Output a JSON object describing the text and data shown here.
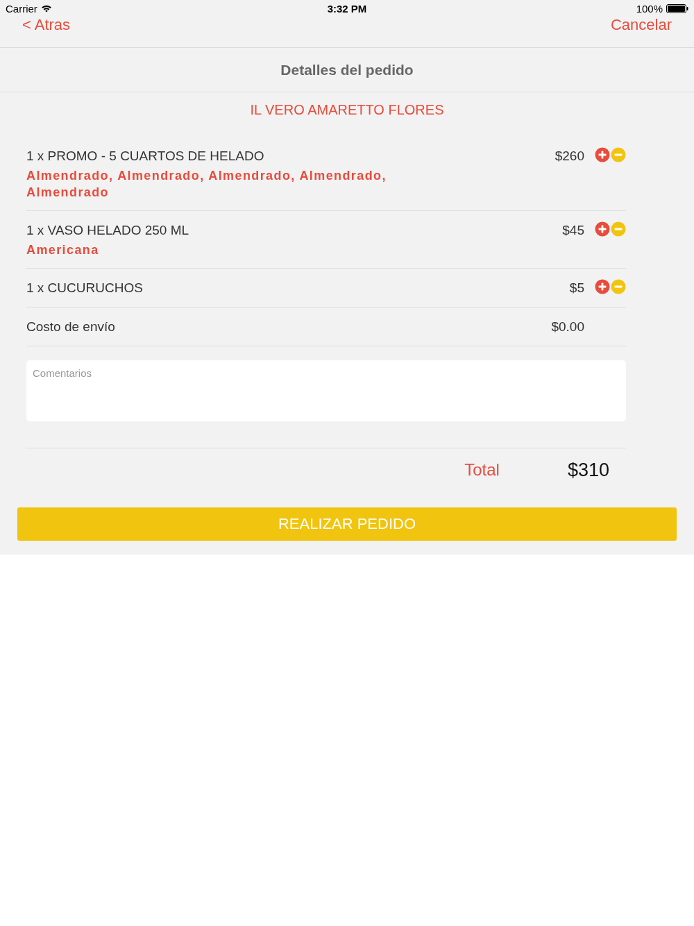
{
  "status_bar": {
    "carrier": "Carrier",
    "time": "3:32 PM",
    "battery": "100%"
  },
  "nav": {
    "back": "< Atras",
    "cancel": "Cancelar"
  },
  "header": {
    "title": "Detalles del pedido"
  },
  "restaurant": "IL VERO AMARETTO FLORES",
  "items": [
    {
      "kind": "product",
      "name": "1 x PROMO - 5 CUARTOS DE HELADO",
      "options": "Almendrado, Almendrado, Almendrado, Almendrado, Almendrado",
      "price": "$260"
    },
    {
      "kind": "product",
      "name": "1 x VASO HELADO 250 ML",
      "options": "Americana",
      "price": "$45"
    },
    {
      "kind": "product",
      "name": "1 x CUCURUCHOS",
      "price": "$5"
    },
    {
      "kind": "shipping",
      "name": "Costo de envío",
      "price": "$0.00"
    }
  ],
  "comments": {
    "placeholder": "Comentarios"
  },
  "total": {
    "label": "Total",
    "value": "$310"
  },
  "submit_button": "REALIZAR PEDIDO"
}
